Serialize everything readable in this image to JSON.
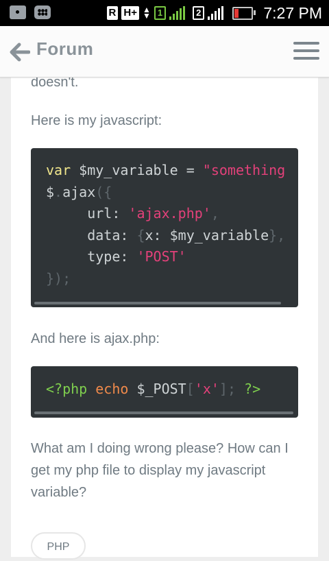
{
  "status_bar": {
    "roaming": "R",
    "network_type": "H+",
    "sim1": "1",
    "sim2": "2",
    "time": "7:27 PM",
    "icons": [
      "camera-icon",
      "bbm-icon",
      "roaming-icon",
      "network-icon",
      "signal-sim1-icon",
      "signal-sim2-icon",
      "battery-icon"
    ],
    "battery_level": 0.2
  },
  "appbar": {
    "back_icon": "back-arrow-icon",
    "title": "Forum",
    "menu_icon": "hamburger-menu-icon"
  },
  "post": {
    "fragment_top": "doesn't.",
    "intro_js": "Here is my javascript:",
    "js_lines": [
      [
        "var",
        " $my_variable = ",
        "\"something"
      ],
      [
        "$",
        ".",
        "ajax",
        "({"
      ],
      [
        "     url: ",
        "'ajax.php'",
        ","
      ],
      [
        "     data: ",
        "{",
        "x: $my_variable",
        "}",
        ","
      ],
      [
        "     type: ",
        "'POST'"
      ],
      [
        "});"
      ]
    ],
    "intro_php": "And here is ajax.php:",
    "php_line": [
      "<?php",
      " ",
      "echo",
      " $_POST",
      "[",
      "'x'",
      "];",
      " ",
      "?>"
    ],
    "question": "What am I doing wrong please? How can I get my php file to display my javascript variable?",
    "tag": "PHP"
  },
  "colors": {
    "keyword": "#f0e68c",
    "string": "#e3417a",
    "punctuation": "#5e666b",
    "php_tag": "#7fcf4e",
    "php_echo": "#f08a4b",
    "code_bg": "#2f3437"
  }
}
